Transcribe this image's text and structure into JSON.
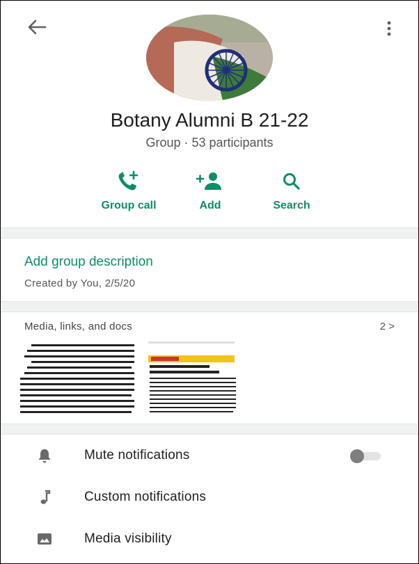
{
  "header": {
    "back_icon": "arrow-left-icon",
    "menu_icon": "more-vertical-icon"
  },
  "group": {
    "name": "Botany Alumni B 21-22",
    "subtitle": "Group · 53 participants"
  },
  "actions": [
    {
      "label": "Group call",
      "icon": "phone-add-icon"
    },
    {
      "label": "Add",
      "icon": "person-add-icon"
    },
    {
      "label": "Search",
      "icon": "search-icon"
    }
  ],
  "description": {
    "title": "Add group description",
    "created": "Created by You, 2/5/20"
  },
  "media": {
    "title": "Media, links, and docs",
    "count": "2 >"
  },
  "settings": [
    {
      "label": "Mute notifications",
      "icon": "bell-icon",
      "toggle": false
    },
    {
      "label": "Custom notifications",
      "icon": "music-note-icon"
    },
    {
      "label": "Media visibility",
      "icon": "image-icon"
    }
  ],
  "colors": {
    "accent": "#0b8e68",
    "divider": "#f0f1f1",
    "toggle_knob": "#7f7f7f"
  }
}
